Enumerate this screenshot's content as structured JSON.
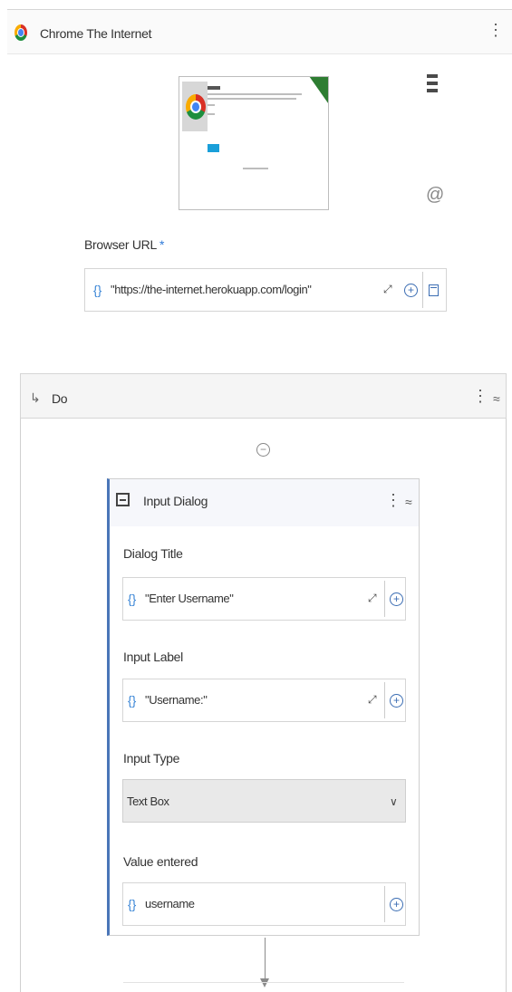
{
  "header": {
    "title": "Chrome The Internet"
  },
  "browser_url": {
    "label": "Browser URL",
    "required_mark": "*",
    "value": "\"https://the-internet.herokuapp.com/login\""
  },
  "do_container": {
    "title": "Do"
  },
  "input_dialog": {
    "title": "Input Dialog",
    "fields": {
      "dialog_title": {
        "label": "Dialog Title",
        "value": "\"Enter Username\""
      },
      "input_label": {
        "label": "Input Label",
        "value": "\"Username:\""
      },
      "input_type": {
        "label": "Input Type",
        "selected": "Text Box"
      },
      "value_entered": {
        "label": "Value entered",
        "value": "username"
      }
    }
  },
  "icons": {
    "braces": "{}",
    "plus": "+",
    "expand": "⤢",
    "kebab": "⋮",
    "collapse": "⌃",
    "chevron_down": "∨"
  },
  "colors": {
    "accent": "#3b86d6",
    "card_border": "#4a76b8"
  }
}
